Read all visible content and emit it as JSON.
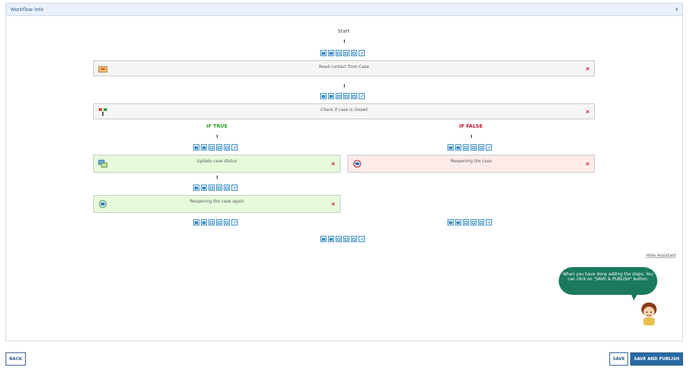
{
  "header": {
    "title": "Workflow Info",
    "chevron_icon": "chevron-right-icon"
  },
  "workflow": {
    "start_label": "Start",
    "toolbar_icons": [
      "add-step-icon",
      "save-step-icon",
      "mail-icon",
      "link-icon",
      "check-icon",
      "edit-icon"
    ],
    "steps": {
      "read_contact": {
        "label": "Read contact from Case",
        "icon": "folder-icon"
      },
      "check_closed": {
        "label": "Check if case is closed",
        "icon": "branch-icon"
      },
      "update_status": {
        "label": "Update case status",
        "icon": "update-icon"
      },
      "reopen": {
        "label": "Reopening the case",
        "icon": "reopen-icon"
      },
      "reopen_again": {
        "label": "Reopening the case again",
        "icon": "reopen-icon"
      }
    },
    "remove_symbol": "×",
    "branches": {
      "true_label": "IF TRUE",
      "false_label": "IF FALSE",
      "true_color": "#2d9c2d",
      "false_color": "#c0142c"
    }
  },
  "assistant": {
    "hide_label": "Hide Assistant",
    "message": "When you have done adding the steps. You can click on \"SAVE & PUBLISH\" button."
  },
  "footer": {
    "back_label": "BACK",
    "save_label": "SAVE",
    "publish_label": "SAVE AND PUBLISH"
  }
}
